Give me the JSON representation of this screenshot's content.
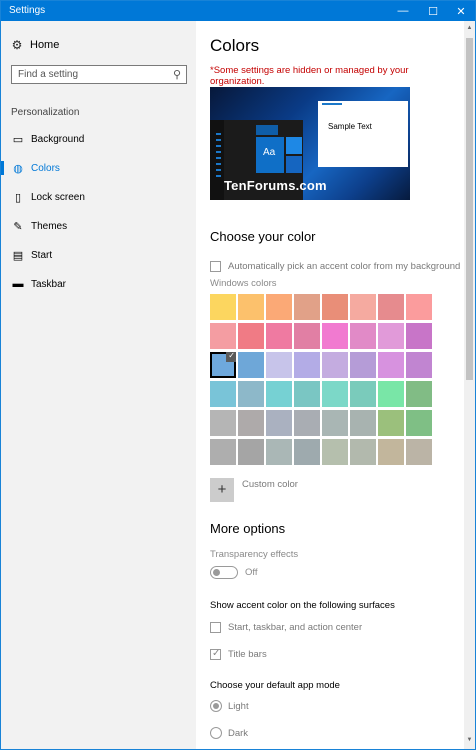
{
  "window": {
    "title": "Settings",
    "minimize": "—",
    "maximize": "☐",
    "close": "✕"
  },
  "sidebar": {
    "home": {
      "label": "Home",
      "icon": "gear-icon"
    },
    "search": {
      "placeholder": "Find a setting"
    },
    "section": "Personalization",
    "items": [
      {
        "label": "Background",
        "icon": "picture-icon",
        "active": false
      },
      {
        "label": "Colors",
        "icon": "palette-icon",
        "active": true
      },
      {
        "label": "Lock screen",
        "icon": "lock-screen-icon",
        "active": false
      },
      {
        "label": "Themes",
        "icon": "brush-icon",
        "active": false
      },
      {
        "label": "Start",
        "icon": "start-icon",
        "active": false
      },
      {
        "label": "Taskbar",
        "icon": "taskbar-icon",
        "active": false
      }
    ]
  },
  "main": {
    "title": "Colors",
    "org_note": "*Some settings are hidden or managed by your organization.",
    "preview": {
      "sample_text": "Sample Text",
      "tile_text": "Aa",
      "watermark": "TenForums.com"
    },
    "choose_color": {
      "heading": "Choose your color",
      "auto_pick_label": "Automatically pick an accent color from my background",
      "auto_pick_checked": false,
      "windows_colors_label": "Windows colors",
      "selected_index": 16,
      "swatches": [
        "#fcd65f",
        "#fcc16c",
        "#fba976",
        "#e1a188",
        "#e98e78",
        "#f5aaa0",
        "#e68b8e",
        "#fb9c9d",
        "#f49da2",
        "#f07b85",
        "#ef7aa1",
        "#e17fa4",
        "#f17ad0",
        "#e18ac7",
        "#e19ad9",
        "#c875c8",
        "#6ea8dc",
        "#6ea7d8",
        "#c7c4ea",
        "#b3ace6",
        "#c4ace0",
        "#b59cd7",
        "#d792df",
        "#c185d1",
        "#79c4d8",
        "#8db8c9",
        "#76d1d3",
        "#7ac6c3",
        "#7cd8c8",
        "#7acbbb",
        "#79e6a7",
        "#81bc85",
        "#b5b5b5",
        "#aeaaaa",
        "#aab1c0",
        "#a9adb3",
        "#a9b6b4",
        "#a8b3b0",
        "#9bc07c",
        "#7fbf85",
        "#aeaeae",
        "#a5a5a5",
        "#aab7b6",
        "#9eaaae",
        "#b5bfad",
        "#b2b9ad",
        "#c2b69c",
        "#bbb4a6"
      ],
      "custom_label": "Custom color",
      "custom_symbol": "+"
    },
    "more_options": {
      "heading": "More options",
      "transparency_label": "Transparency effects",
      "transparency_state": "Off",
      "transparency_on": false,
      "accent_surfaces_label": "Show accent color on the following surfaces",
      "surfaces": [
        {
          "label": "Start, taskbar, and action center",
          "checked": false
        },
        {
          "label": "Title bars",
          "checked": true
        }
      ],
      "app_mode_label": "Choose your default app mode",
      "modes": [
        {
          "label": "Light",
          "selected": true
        },
        {
          "label": "Dark",
          "selected": false
        }
      ]
    }
  },
  "colors": {
    "accent": "#0078d7",
    "warning": "#c40000",
    "sidebar_bg": "#f2f2f2"
  }
}
